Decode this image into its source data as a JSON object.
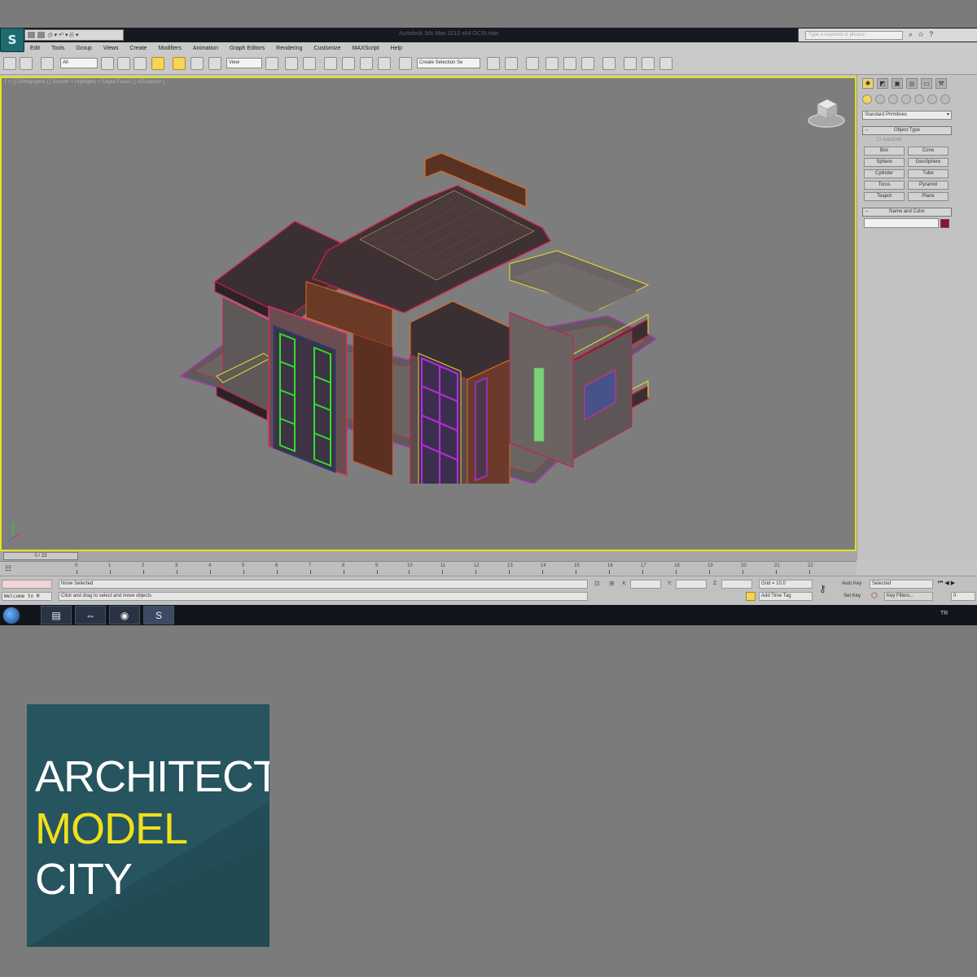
{
  "titlebar": {
    "title": "Autodesk 3ds Max 2012 x64    OCSt.max",
    "search_placeholder": "Type a keyword or phrase",
    "quick_access": "◷ ▾ ↶ ▾ ⎘ ▾",
    "icons": [
      "search-icon",
      "star-icon",
      "help-icon"
    ]
  },
  "app_logo": "S",
  "menu": [
    "Edit",
    "Tools",
    "Group",
    "Views",
    "Create",
    "Modifiers",
    "Animation",
    "Graph Editors",
    "Rendering",
    "Customize",
    "MAXScript",
    "Help"
  ],
  "toolbar": {
    "selection_filter": "All",
    "reference_coord": "View",
    "named_selection": "Create Selection Se"
  },
  "viewport": {
    "label": "[ + ] [ Orthographic ] [ Smooth + Highlights + Edged Faces ] [ <Disabled> ]",
    "border_color": "#e4e21c"
  },
  "command_panel": {
    "dropdown": "Standard Primitives",
    "object_type_header": "Object Type",
    "autogrid_label": "AutoGrid",
    "primitives": [
      "Box",
      "Cone",
      "Sphere",
      "GeoSphere",
      "Cylinder",
      "Tube",
      "Torus",
      "Pyramid",
      "Teapot",
      "Plane"
    ],
    "name_color_header": "Name and Color",
    "object_color": "#9b0b3a"
  },
  "timeline": {
    "frame_indicator": "0 / 23",
    "ticks": [
      "0",
      "1",
      "2",
      "3",
      "4",
      "5",
      "6",
      "7",
      "8",
      "9",
      "10",
      "11",
      "12",
      "13",
      "14",
      "15",
      "16",
      "17",
      "18",
      "19",
      "20",
      "21",
      "22"
    ]
  },
  "status": {
    "maxscript_listener": "Welcome to M",
    "selection_status": "None Selected",
    "prompt": "Click and drag to select and move objects",
    "x_label": "X:",
    "y_label": "Y:",
    "z_label": "Z:",
    "grid": "Grid = 10,0",
    "add_time_tag": "Add Time Tag",
    "auto_key": "Auto Key",
    "set_key": "Set Key",
    "key_mode": "Selected",
    "key_filters": "Key Filters...",
    "frame_field": "0"
  },
  "taskbar": {
    "tray_language": "TR",
    "items": [
      "folder-icon",
      "teamviewer-icon",
      "chrome-icon",
      "3dsmax-icon"
    ]
  },
  "brand": {
    "line1": "ARCHITECT",
    "line2": "MODEL",
    "line3": "CITY",
    "background": "#234e58",
    "accent": "#f0e01a"
  }
}
